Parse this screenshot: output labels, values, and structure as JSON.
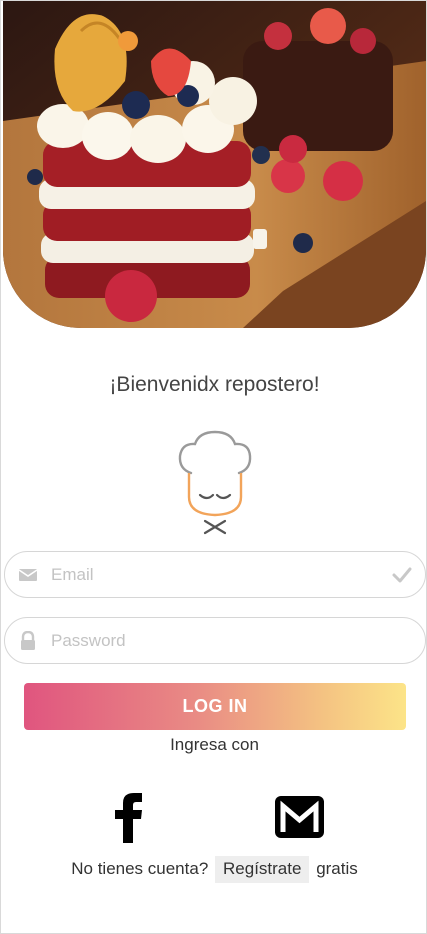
{
  "hero": {
    "image": "red-velvet-cake-photo"
  },
  "welcome": {
    "title": "¡Bienvenidx repostero!"
  },
  "logo": {
    "icon": "chef-hat-icon"
  },
  "form": {
    "email": {
      "placeholder": "Email",
      "icon": "envelope-icon",
      "status_icon": "check-icon"
    },
    "password": {
      "placeholder": "Password",
      "icon": "lock-icon"
    },
    "login_label": "LOG IN"
  },
  "social": {
    "prompt": "Ingresa con",
    "facebook_icon": "facebook-icon",
    "gmail_icon": "gmail-icon"
  },
  "signup": {
    "before": "No tienes cuenta?",
    "link": "Regístrate",
    "after": "gratis"
  },
  "colors": {
    "gradient_start": "#e0557f",
    "gradient_end": "#fce488",
    "chef_orange": "#f2a45a"
  }
}
